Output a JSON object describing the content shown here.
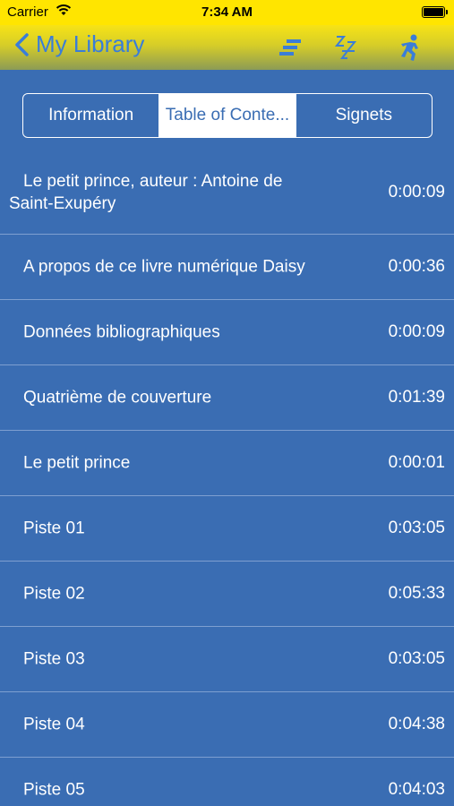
{
  "status": {
    "carrier": "Carrier",
    "time": "7:34 AM"
  },
  "nav": {
    "back_label": "My Library",
    "icons": [
      "sort-lines-icon",
      "sleep-timer-icon",
      "running-man-icon"
    ]
  },
  "segments": [
    {
      "label": "Information",
      "active": false
    },
    {
      "label": "Table of Conte...",
      "active": true
    },
    {
      "label": "Signets",
      "active": false
    }
  ],
  "toc": [
    {
      "title": "Le petit prince, auteur  : Antoine de Saint-Exupéry",
      "duration": "0:00:09"
    },
    {
      "title": "A propos de ce livre numérique Daisy",
      "duration": "0:00:36"
    },
    {
      "title": "Données bibliographiques",
      "duration": "0:00:09"
    },
    {
      "title": "Quatrième de couverture",
      "duration": "0:01:39"
    },
    {
      "title": "Le petit prince",
      "duration": "0:00:01"
    },
    {
      "title": "Piste 01",
      "duration": "0:03:05"
    },
    {
      "title": "Piste 02",
      "duration": "0:05:33"
    },
    {
      "title": "Piste 03",
      "duration": "0:03:05"
    },
    {
      "title": "Piste 04",
      "duration": "0:04:38"
    },
    {
      "title": "Piste 05",
      "duration": "0:04:03"
    }
  ],
  "colors": {
    "background": "#3a6db3",
    "status_bar": "#ffe500",
    "accent": "#3a7dd8",
    "separator": "#7e9fd0"
  }
}
